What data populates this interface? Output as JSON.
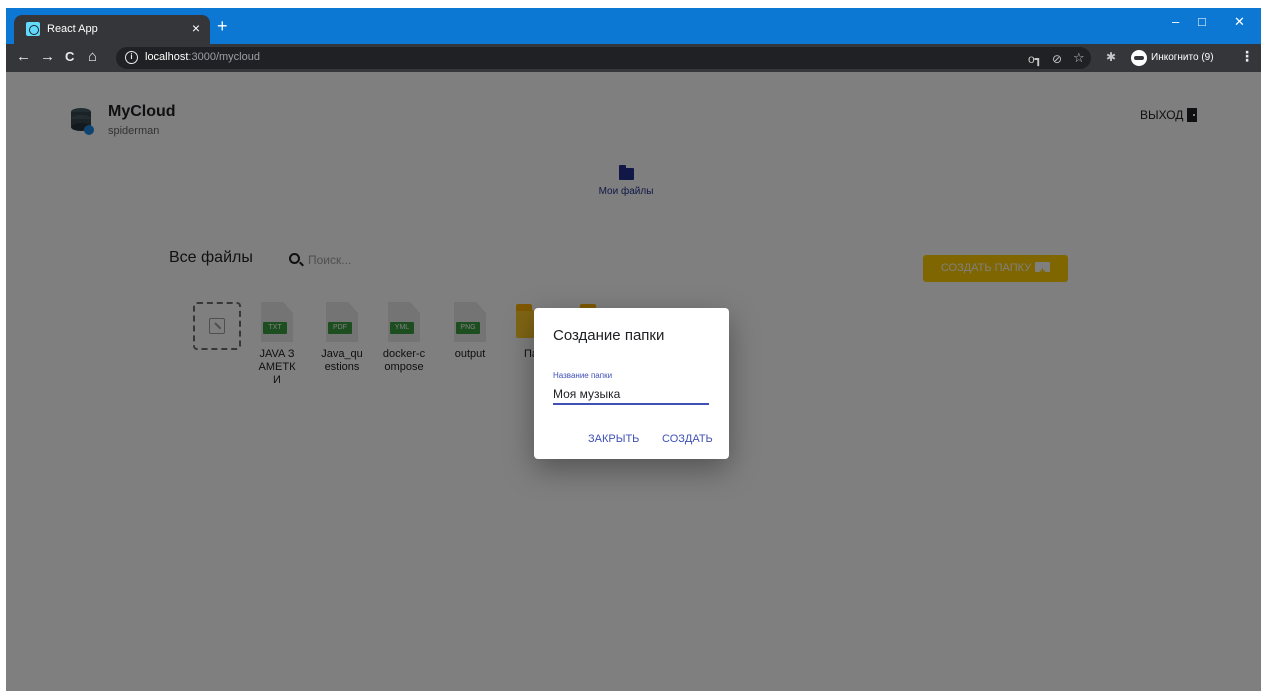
{
  "browser": {
    "tab_title": "React App",
    "tab_close": "×",
    "new_tab": "+",
    "window_controls": {
      "minimize": "–",
      "maximize": "□",
      "close": "✕"
    },
    "nav": {
      "back": "←",
      "forward": "→",
      "reload": "C",
      "home": "⌂"
    },
    "url_host": "localhost",
    "url_path": ":3000/mycloud",
    "incognito_label": "Инкогнито (9)",
    "menu": "⋮",
    "toolbar_icons": {
      "key": "o┓",
      "eye_off": "⊘",
      "star": "☆",
      "puzzle": "✱"
    }
  },
  "header": {
    "app_name": "MyCloud",
    "username": "spiderman",
    "logout_label": "ВЫХОД"
  },
  "nav": {
    "my_files": "Мои файлы"
  },
  "toolbar": {
    "title": "Все файлы",
    "search_placeholder": "Поиск...",
    "create_folder_label": "СОЗДАТЬ ПАПКУ"
  },
  "files": [
    {
      "name": "JAVA ЗАМЕТКИ",
      "ext": "TXT"
    },
    {
      "name": "Java_questions",
      "ext": "PDF"
    },
    {
      "name": "docker-compose",
      "ext": "YML"
    },
    {
      "name": "output",
      "ext": "PNG"
    }
  ],
  "folders": [
    {
      "name": "Пап"
    },
    {
      "name": ""
    }
  ],
  "dialog": {
    "title": "Создание папки",
    "field_label": "Название папки",
    "field_value": "Моя музыка",
    "close_label": "ЗАКРЫТЬ",
    "create_label": "СОЗДАТЬ"
  },
  "colors": {
    "accent": "#3f51b5",
    "nav_accent": "#22308f",
    "create_button": "#ffcd00",
    "folder": "#ffca28",
    "file_badge": "#3b9d3f",
    "chrome_tabstrip": "#0c78d4",
    "chrome_toolbar": "#35363a"
  }
}
